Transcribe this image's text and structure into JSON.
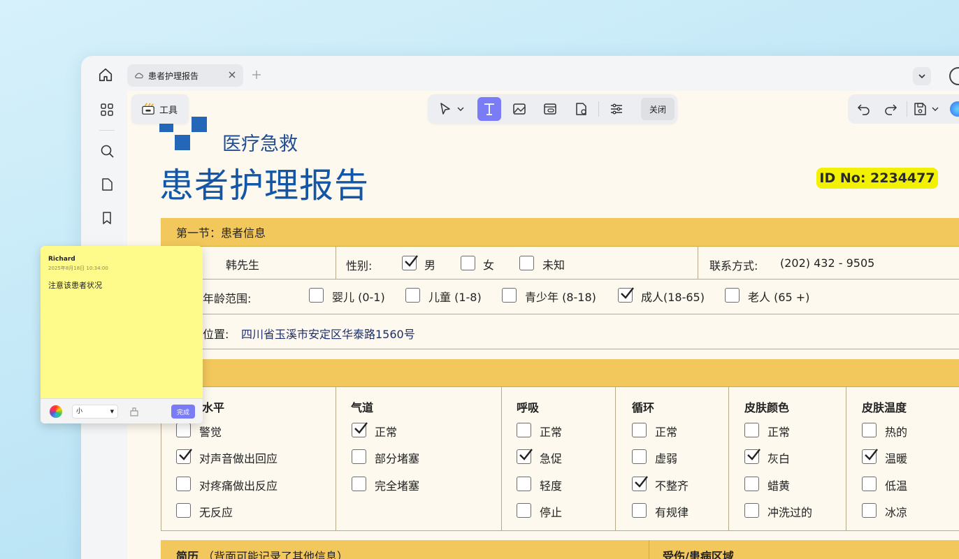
{
  "tab": {
    "title": "患者护理报告"
  },
  "tools": {
    "label": "工具"
  },
  "toolbar": {
    "close_label": "关闭"
  },
  "doc": {
    "org_name": "医疗急救",
    "title": "患者护理报告",
    "id_no": "ID No: 2234477",
    "section1": {
      "header": "第一节：患者信息",
      "name_value": "韩先生",
      "gender_label": "性别:",
      "gender_options": [
        {
          "label": "男",
          "checked": true
        },
        {
          "label": "女",
          "checked": false
        },
        {
          "label": "未知",
          "checked": false
        }
      ],
      "contact_label": "联系方式:",
      "contact_value": "(202) 432 - 9505",
      "age_label": "年龄范围:",
      "age_options": [
        {
          "label": "婴儿 (0-1)",
          "checked": false
        },
        {
          "label": "儿童 (1-8)",
          "checked": false
        },
        {
          "label": "青少年 (8-18)",
          "checked": false
        },
        {
          "label": "成人(18-65)",
          "checked": true
        },
        {
          "label": "老人 (65 +)",
          "checked": false
        }
      ],
      "location_label": "位置:",
      "location_value": "四川省玉溪市安定区华泰路1560号"
    },
    "section2": {
      "columns": [
        {
          "header": "水平",
          "items": [
            {
              "label": "警觉",
              "checked": false
            },
            {
              "label": "对声音做出回应",
              "checked": true
            },
            {
              "label": "对疼痛做出反应",
              "checked": false
            },
            {
              "label": "无反应",
              "checked": false
            }
          ]
        },
        {
          "header": "气道",
          "items": [
            {
              "label": "正常",
              "checked": true
            },
            {
              "label": "部分堵塞",
              "checked": false
            },
            {
              "label": "完全堵塞",
              "checked": false
            }
          ]
        },
        {
          "header": "呼吸",
          "items": [
            {
              "label": "正常",
              "checked": false
            },
            {
              "label": "急促",
              "checked": true
            },
            {
              "label": "轻度",
              "checked": false
            },
            {
              "label": "停止",
              "checked": false
            }
          ]
        },
        {
          "header": "循环",
          "items": [
            {
              "label": "正常",
              "checked": false
            },
            {
              "label": "虚弱",
              "checked": false
            },
            {
              "label": "不整齐",
              "checked": true
            },
            {
              "label": "有规律",
              "checked": false
            }
          ]
        },
        {
          "header": "皮肤颜色",
          "items": [
            {
              "label": "正常",
              "checked": false
            },
            {
              "label": "灰白",
              "checked": true
            },
            {
              "label": "蜡黄",
              "checked": false
            },
            {
              "label": "冲洗过的",
              "checked": false
            }
          ]
        },
        {
          "header": "皮肤温度",
          "items": [
            {
              "label": "热的",
              "checked": false
            },
            {
              "label": "温暖",
              "checked": true
            },
            {
              "label": "低温",
              "checked": false
            },
            {
              "label": "冰凉",
              "checked": false
            }
          ]
        }
      ]
    },
    "section3": {
      "history_label": "简历",
      "history_note": "（背面可能记录了其他信息）",
      "injury_label": "受伤/患病区域"
    }
  },
  "note": {
    "author": "Richard",
    "time": "2025年8月18日 10:34:00",
    "body": "注意该患者状况",
    "size_value": "小",
    "done_label": "完成"
  },
  "colors": {
    "accent": "#7a7cf5",
    "band": "#f2c85c",
    "title": "#1456a6",
    "note": "#fffb8a",
    "badge": "#f2f101"
  }
}
